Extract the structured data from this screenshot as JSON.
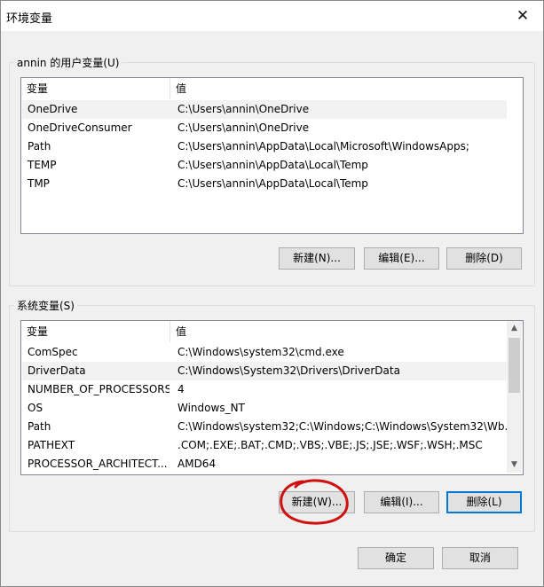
{
  "window": {
    "title": "环境变量",
    "close_glyph": "✕"
  },
  "user_vars": {
    "group_label": "annin 的用户变量(U)",
    "col_name": "变量",
    "col_value": "值",
    "rows": [
      {
        "name": "OneDrive",
        "value": "C:\\Users\\annin\\OneDrive",
        "selected": true
      },
      {
        "name": "OneDriveConsumer",
        "value": "C:\\Users\\annin\\OneDrive",
        "selected": false
      },
      {
        "name": "Path",
        "value": "C:\\Users\\annin\\AppData\\Local\\Microsoft\\WindowsApps;",
        "selected": false
      },
      {
        "name": "TEMP",
        "value": "C:\\Users\\annin\\AppData\\Local\\Temp",
        "selected": false
      },
      {
        "name": "TMP",
        "value": "C:\\Users\\annin\\AppData\\Local\\Temp",
        "selected": false
      }
    ],
    "new_label": "新建(N)...",
    "edit_label": "编辑(E)...",
    "delete_label": "删除(D)"
  },
  "system_vars": {
    "group_label": "系统变量(S)",
    "col_name": "变量",
    "col_value": "值",
    "rows": [
      {
        "name": "ComSpec",
        "value": "C:\\Windows\\system32\\cmd.exe",
        "selected": false
      },
      {
        "name": "DriverData",
        "value": "C:\\Windows\\System32\\Drivers\\DriverData",
        "selected": true
      },
      {
        "name": "NUMBER_OF_PROCESSORS",
        "value": "4",
        "selected": false
      },
      {
        "name": "OS",
        "value": "Windows_NT",
        "selected": false
      },
      {
        "name": "Path",
        "value": "C:\\Windows\\system32;C:\\Windows;C:\\Windows\\System32\\Wb...",
        "selected": false
      },
      {
        "name": "PATHEXT",
        "value": ".COM;.EXE;.BAT;.CMD;.VBS;.VBE;.JS;.JSE;.WSF;.WSH;.MSC",
        "selected": false
      },
      {
        "name": "PROCESSOR_ARCHITECT...",
        "value": "AMD64",
        "selected": false
      }
    ],
    "new_label": "新建(W)...",
    "edit_label": "编辑(I)...",
    "delete_label": "删除(L)"
  },
  "footer": {
    "ok_label": "确定",
    "cancel_label": "取消"
  },
  "colors": {
    "focus_border": "#0078d7",
    "annotation_circle": "#d01010",
    "selected_row": "#f2f2f2"
  }
}
